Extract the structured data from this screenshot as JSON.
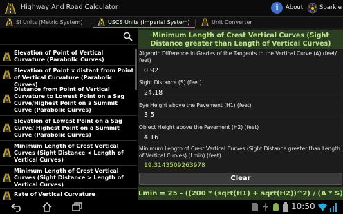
{
  "app": {
    "title": "Highway And Road Calculator",
    "about_label": "About",
    "sparkle_label": "Sparkle"
  },
  "tabs": [
    {
      "label": "SI Units (Metric System)",
      "active": false
    },
    {
      "label": "USCS Units (Imperial System)",
      "active": true
    },
    {
      "label": "Unit Converter",
      "active": false
    }
  ],
  "list_items": [
    {
      "label": "Elevation of Point of Vertical Curvature (Parabolic Curves)"
    },
    {
      "label": "Elevation of Point x distant from Point of Vertical Curvature (Parabolic Curves)"
    },
    {
      "label": "Distance from Point of Vertical Curvature to Lowest Point on a Sag Curve/Highest Point on a Summit Curve (Parabolic Curves)"
    },
    {
      "label": "Elevation of Lowest Point on a Sag Curve/ Highest Point on a Summit Curve (Parabolic Curves)"
    },
    {
      "label": "Minimum Length of Crest Vertical Curves (Sight Distance < Length of Vertical Curves)"
    },
    {
      "label": "Minimum Length of Crest Vertical Curves (Sight Distance > Length of Vertical Curves)"
    },
    {
      "label": "Rate of Vertical Curvature"
    }
  ],
  "form": {
    "title": "Minimum Length of Crest Vertical Curves (Sight Distance greater than Length of Vertical Curves)",
    "fields": [
      {
        "label": "Algebric Difference in Grades of the Tangents to the Vertical Curve (A) (feet/ feet)",
        "value": "0.92"
      },
      {
        "label": "Sight Distance (S) (feet)",
        "value": "24.18"
      },
      {
        "label": "Eye Height above the Pavement (H1) (feet)",
        "value": "3.5"
      },
      {
        "label": "Object Height above the Pavement (H2) (feet)",
        "value": "4.16"
      }
    ],
    "result_label": "Minimum Length of Crest Vertical Curves (Sight Distance greater than Length of Vertical Curves) (Lmin) (feet)",
    "result_value": "19.3143509263978",
    "clear_label": "Clear",
    "formula": "Lmin = 25 - ((200 * (sqrt(H1) + sqrt(H2))^2) / (A * S))"
  },
  "system": {
    "clock": "10:50"
  },
  "colors": {
    "accent": "#29a9e0",
    "header_bg": "#2c3e21",
    "header_text": "#bde38a",
    "result_text": "#b6e36e"
  }
}
